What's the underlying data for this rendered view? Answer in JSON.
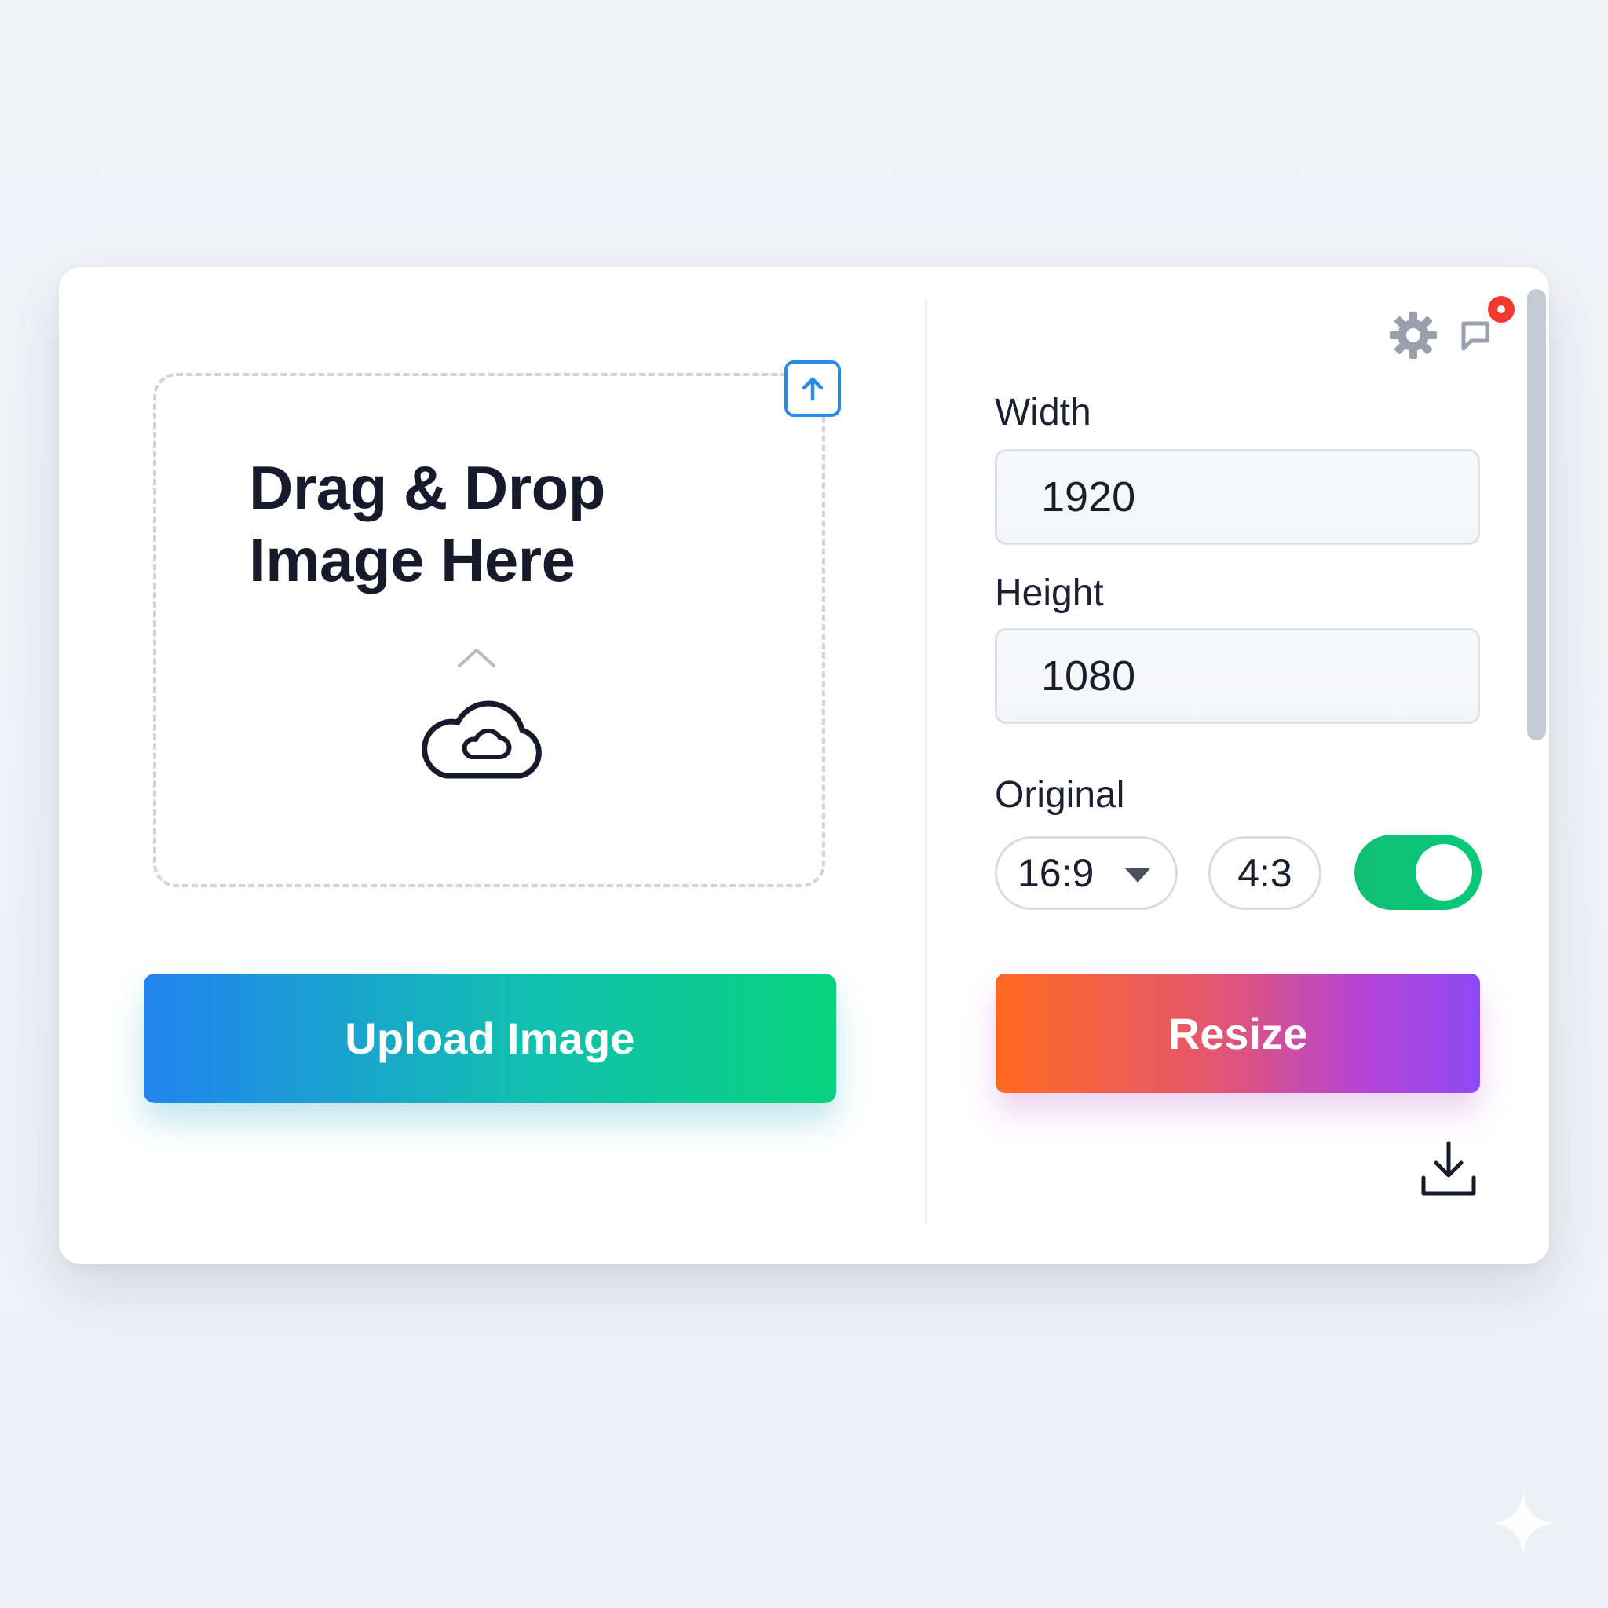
{
  "dropzone": {
    "title_line1": "Drag & Drop",
    "title_line2": "Image Here"
  },
  "upload_button": {
    "label": "Upload Image"
  },
  "dimensions": {
    "width_label": "Width",
    "width_value": "1920",
    "height_label": "Height",
    "height_value": "1080"
  },
  "aspect": {
    "label": "Original",
    "ratio_select_value": "16:9",
    "ratio_alt": "4:3",
    "toggle_on": true
  },
  "resize_button": {
    "label": "Resize"
  },
  "colors": {
    "upload_gradient_start": "#2184f0",
    "upload_gradient_end": "#08d27e",
    "resize_gradient_start": "#ff6a22",
    "resize_gradient_end": "#8f48f7",
    "toggle_on": "#0fbf72",
    "accent_blue": "#2a8ae6",
    "notification_dot": "#f0382f"
  },
  "icons": {
    "corner": "upload-arrow-icon",
    "chevron": "chevron-up-icon",
    "cloud": "cloud-icon",
    "settings": "gear-icon",
    "notification": "notification-icon",
    "download": "download-icon"
  }
}
